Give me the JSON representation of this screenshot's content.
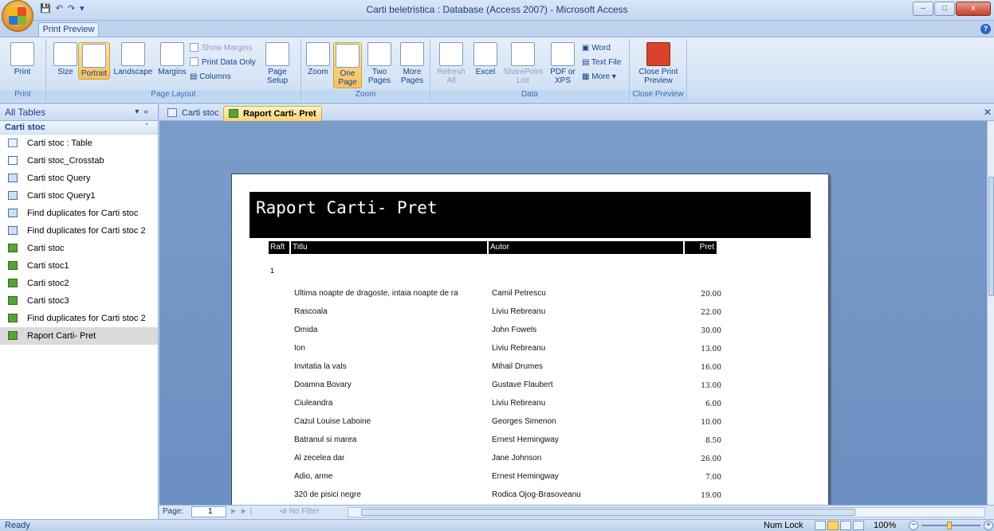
{
  "window": {
    "title": "Carti beletristica : Database (Access 2007) - Microsoft Access",
    "controls": [
      "–",
      "□",
      "x"
    ]
  },
  "ribbon": {
    "active_tab": "Print Preview",
    "groups": {
      "print": {
        "label": "Print",
        "print_btn": "Print"
      },
      "page_layout": {
        "label": "Page Layout",
        "size": "Size",
        "portrait": "Portrait",
        "landscape": "Landscape",
        "margins": "Margins",
        "show_margins": "Show Margins",
        "print_data_only": "Print Data Only",
        "columns": "Columns",
        "page_setup": "Page Setup"
      },
      "zoom": {
        "label": "Zoom",
        "zoom": "Zoom",
        "one_page": "One Page",
        "two_pages": "Two Pages",
        "more_pages": "More Pages"
      },
      "data": {
        "label": "Data",
        "refresh_all": "Refresh All",
        "excel": "Excel",
        "sharepoint": "SharePoint List",
        "pdf": "PDF or XPS",
        "word": "Word",
        "text_file": "Text File",
        "more": "More"
      },
      "close_preview": {
        "label": "Close Preview",
        "close_btn": "Close Print Preview"
      }
    }
  },
  "nav_pane": {
    "header": "All Tables",
    "group": "Carti stoc",
    "items": [
      {
        "label": "Carti stoc : Table",
        "type": "table"
      },
      {
        "label": "Carti stoc_Crosstab",
        "type": "crosstab"
      },
      {
        "label": "Carti stoc Query",
        "type": "query"
      },
      {
        "label": "Carti stoc Query1",
        "type": "query"
      },
      {
        "label": "Find duplicates for Carti stoc",
        "type": "query"
      },
      {
        "label": "Find duplicates for Carti stoc 2",
        "type": "query"
      },
      {
        "label": "Carti stoc",
        "type": "report"
      },
      {
        "label": "Carti stoc1",
        "type": "report"
      },
      {
        "label": "Carti stoc2",
        "type": "report"
      },
      {
        "label": "Carti stoc3",
        "type": "report"
      },
      {
        "label": "Find duplicates for Carti stoc 2",
        "type": "report"
      },
      {
        "label": "Raport Carti- Pret",
        "type": "report"
      }
    ],
    "selected_index": 11
  },
  "doc_tabs": [
    "Carti stoc",
    "Raport Carti- Pret"
  ],
  "report": {
    "title": "Raport Carti- Pret",
    "columns": {
      "raft": "Raft",
      "titlu": "Titlu",
      "autor": "Autor",
      "pret": "Pret"
    },
    "group_value": "1",
    "rows": [
      {
        "titlu": "Ultima noapte de dragoste, intaia noapte de ra",
        "autor": "Camil Petrescu",
        "pret": "20.00"
      },
      {
        "titlu": "Rascoala",
        "autor": "Liviu Rebreanu",
        "pret": "22.00"
      },
      {
        "titlu": "Omida",
        "autor": "John Fowels",
        "pret": "30.00"
      },
      {
        "titlu": "Ion",
        "autor": "Liviu Rebreanu",
        "pret": "13.00"
      },
      {
        "titlu": "Invitatia la vals",
        "autor": "Mihail Drumes",
        "pret": "16.00"
      },
      {
        "titlu": "Doamna Bovary",
        "autor": "Gustave Flaubert",
        "pret": "13.00"
      },
      {
        "titlu": "Ciuleandra",
        "autor": "Liviu Rebreanu",
        "pret": "6.00"
      },
      {
        "titlu": "Cazul Louise Laboine",
        "autor": "Georges Simenon",
        "pret": "10.00"
      },
      {
        "titlu": "Batranul si marea",
        "autor": "Ernest Hemingway",
        "pret": "8.50"
      },
      {
        "titlu": "Al zecelea dar",
        "autor": "Jane Johnson",
        "pret": "26.00"
      },
      {
        "titlu": "Adio, arme",
        "autor": "Ernest Hemingway",
        "pret": "7.00"
      },
      {
        "titlu": "320 de pisici negre",
        "autor": "Rodica Ojog-Brasoveanu",
        "pret": "19.00"
      }
    ]
  },
  "record_nav": {
    "label": "Page:",
    "page": "1",
    "filter": "No Filter"
  },
  "status": {
    "left": "Ready",
    "num_lock": "Num Lock",
    "zoom": "100%"
  }
}
